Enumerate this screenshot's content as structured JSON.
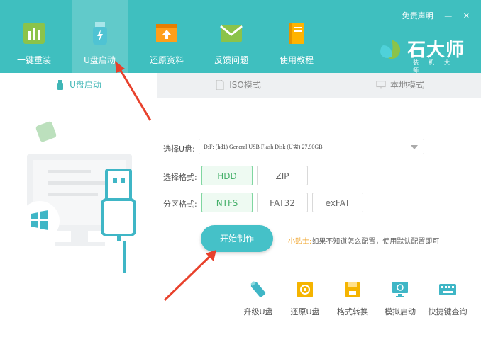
{
  "header": {
    "tabs": [
      {
        "label": "一键重装",
        "icon": "bar-chart-icon"
      },
      {
        "label": "U盘启动",
        "icon": "usb-drive-icon"
      },
      {
        "label": "还原资料",
        "icon": "restore-folder-icon"
      },
      {
        "label": "反馈问题",
        "icon": "feedback-envelope-icon"
      },
      {
        "label": "使用教程",
        "icon": "tutorial-book-icon"
      }
    ],
    "disclaimer": "免责声明",
    "minimize": "—",
    "close": "✕",
    "brand_name": "石大师",
    "brand_sub": "装机大师"
  },
  "subtabs": [
    {
      "label": "U盘启动",
      "icon": "usb-icon"
    },
    {
      "label": "ISO模式",
      "icon": "file-icon"
    },
    {
      "label": "本地模式",
      "icon": "monitor-icon"
    }
  ],
  "form": {
    "usb_label": "选择U盘:",
    "usb_value": "D:F: (hd1) General USB Flash Disk (U盘) 27.90GB",
    "format_label": "选择格式:",
    "formats": [
      "HDD",
      "ZIP"
    ],
    "selected_format": "HDD",
    "partition_label": "分区格式:",
    "partitions": [
      "NTFS",
      "FAT32",
      "exFAT"
    ],
    "selected_partition": "NTFS"
  },
  "start_button": "开始制作",
  "tip": {
    "prefix": "小贴士:",
    "text": "如果不知道怎么配置，使用默认配置即可"
  },
  "tools": [
    {
      "label": "升级U盘",
      "icon": "upgrade-usb-icon"
    },
    {
      "label": "还原U盘",
      "icon": "restore-usb-icon"
    },
    {
      "label": "格式转换",
      "icon": "format-convert-icon"
    },
    {
      "label": "模拟启动",
      "icon": "simulate-boot-icon"
    },
    {
      "label": "快捷键查询",
      "icon": "keyboard-icon"
    }
  ],
  "colors": {
    "header": "#3fbfbf",
    "accent": "#45c1c8",
    "selected_green": "#45b06a",
    "tip_orange": "#f0a020",
    "arrow_red": "#e8412c"
  }
}
